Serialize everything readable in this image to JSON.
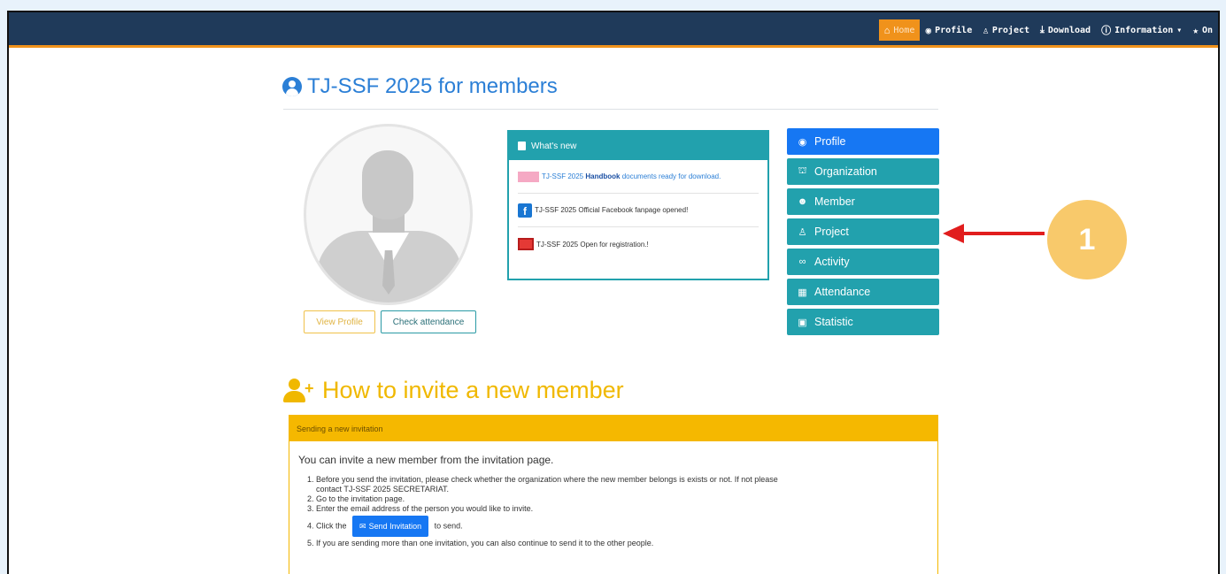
{
  "nav": {
    "items": [
      {
        "label": "Home",
        "icon": "home-icon",
        "active": true
      },
      {
        "label": "Profile",
        "icon": "user-circle-icon"
      },
      {
        "label": "Project",
        "icon": "project-icon"
      },
      {
        "label": "Download",
        "icon": "download-icon"
      },
      {
        "label": "Information",
        "icon": "info-icon",
        "caret": "▾"
      },
      {
        "label": "On",
        "icon": "star-icon"
      }
    ],
    "colors": {
      "bar": "#1f3a5a",
      "accent": "#f0921b"
    }
  },
  "page": {
    "title": "TJ-SSF 2025 for members"
  },
  "profile": {
    "view_button": "View Profile",
    "check_button": "Check attendance"
  },
  "news": {
    "header": "What's new",
    "items": [
      {
        "pre": "TJ-SSF 2025 ",
        "strong": "Handbook",
        "post": " documents ready for download.",
        "icon": "book-icon"
      },
      {
        "pre": "TJ-SSF 2025 Official Facebook fanpage opened!",
        "icon": "facebook-icon"
      },
      {
        "pre": "TJ-SSF 2025 Open for registration.!",
        "icon": "registration-icon"
      }
    ]
  },
  "side_menu": [
    {
      "label": "Profile",
      "icon": "user-circle-icon",
      "primary": true
    },
    {
      "label": "Organization",
      "icon": "organization-icon"
    },
    {
      "label": "Member",
      "icon": "users-icon"
    },
    {
      "label": "Project",
      "icon": "project-icon"
    },
    {
      "label": "Activity",
      "icon": "binoculars-icon"
    },
    {
      "label": "Attendance",
      "icon": "calendar-icon"
    },
    {
      "label": "Statistic",
      "icon": "chart-icon"
    }
  ],
  "annotation": {
    "badge": "1"
  },
  "invite": {
    "title": "How to invite a new member",
    "panel_header": "Sending a new invitation",
    "lead": "You can invite a new member from the invitation page.",
    "steps": [
      "1. Before you send the invitation, please check whether the organization where the new member belongs is exists or not. If not please",
      "contact TJ-SSF 2025 SECRETARIAT.",
      "2. Go to the invitation page.",
      "3. Enter the email address of the person you would like to invite."
    ],
    "step4_pre": "4. Click the",
    "send_button": "Send Invitation",
    "step4_post": "to send.",
    "step5": "5. If you are sending more than one invitation, you can also continue to send it to the other people."
  }
}
